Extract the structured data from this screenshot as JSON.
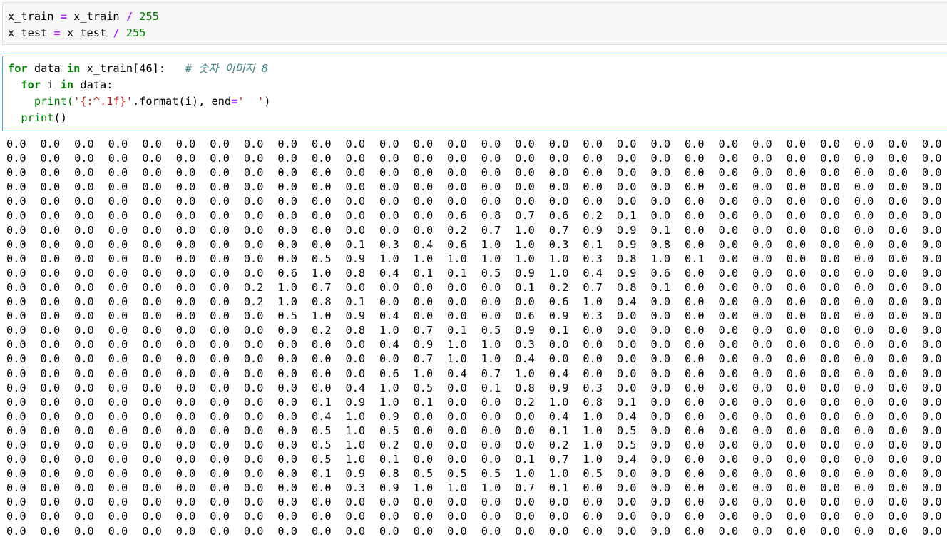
{
  "cell1": {
    "lines": [
      {
        "var": "x_train",
        "eq": "=",
        "src": "x_train",
        "op": "/",
        "num": "255"
      },
      {
        "var": "x_test",
        "eq": "=",
        "src": "x_test",
        "op": "/",
        "num": "255"
      }
    ]
  },
  "cell2": {
    "line1": {
      "kw_for": "for",
      "var": "data",
      "kw_in": "in",
      "iter": "x_train[46]:",
      "comment": "# 숫자 이미지 8"
    },
    "line2": {
      "kw_for": "for",
      "var": "i",
      "kw_in": "in",
      "iter": "data:"
    },
    "line3": {
      "fn": "print(",
      "str1": "'{:^.1f}'",
      "method": ".format",
      "args": "(i), ",
      "kw": "end",
      "eq": "=",
      "str2": "'  '",
      "close": ")"
    },
    "line4": {
      "fn": "print",
      "args": "()"
    }
  },
  "output": {
    "rows": [
      "0.0 0.0 0.0 0.0 0.0 0.0 0.0 0.0 0.0 0.0 0.0 0.0 0.0 0.0 0.0 0.0 0.0 0.0 0.0 0.0 0.0 0.0 0.0 0.0 0.0 0.0 0.0 0.0",
      "0.0 0.0 0.0 0.0 0.0 0.0 0.0 0.0 0.0 0.0 0.0 0.0 0.0 0.0 0.0 0.0 0.0 0.0 0.0 0.0 0.0 0.0 0.0 0.0 0.0 0.0 0.0 0.0",
      "0.0 0.0 0.0 0.0 0.0 0.0 0.0 0.0 0.0 0.0 0.0 0.0 0.0 0.0 0.0 0.0 0.0 0.0 0.0 0.0 0.0 0.0 0.0 0.0 0.0 0.0 0.0 0.0",
      "0.0 0.0 0.0 0.0 0.0 0.0 0.0 0.0 0.0 0.0 0.0 0.0 0.0 0.0 0.0 0.0 0.0 0.0 0.0 0.0 0.0 0.0 0.0 0.0 0.0 0.0 0.0 0.0",
      "0.0 0.0 0.0 0.0 0.0 0.0 0.0 0.0 0.0 0.0 0.0 0.0 0.0 0.0 0.0 0.0 0.0 0.0 0.0 0.0 0.0 0.0 0.0 0.0 0.0 0.0 0.0 0.0",
      "0.0 0.0 0.0 0.0 0.0 0.0 0.0 0.0 0.0 0.0 0.0 0.0 0.0 0.6 0.8 0.7 0.6 0.2 0.1 0.0 0.0 0.0 0.0 0.0 0.0 0.0 0.0 0.0",
      "0.0 0.0 0.0 0.0 0.0 0.0 0.0 0.0 0.0 0.0 0.0 0.0 0.0 0.2 0.7 1.0 0.7 0.9 0.9 0.1 0.0 0.0 0.0 0.0 0.0 0.0 0.0 0.0",
      "0.0 0.0 0.0 0.0 0.0 0.0 0.0 0.0 0.0 0.0 0.1 0.3 0.4 0.6 1.0 1.0 0.3 0.1 0.9 0.8 0.0 0.0 0.0 0.0 0.0 0.0 0.0 0.0",
      "0.0 0.0 0.0 0.0 0.0 0.0 0.0 0.0 0.0 0.5 0.9 1.0 1.0 1.0 1.0 1.0 1.0 0.3 0.8 1.0 0.1 0.0 0.0 0.0 0.0 0.0 0.0 0.0",
      "0.0 0.0 0.0 0.0 0.0 0.0 0.0 0.0 0.6 1.0 0.8 0.4 0.1 0.1 0.5 0.9 1.0 0.4 0.9 0.6 0.0 0.0 0.0 0.0 0.0 0.0 0.0 0.0",
      "0.0 0.0 0.0 0.0 0.0 0.0 0.0 0.2 1.0 0.7 0.0 0.0 0.0 0.0 0.0 0.1 0.2 0.7 0.8 0.1 0.0 0.0 0.0 0.0 0.0 0.0 0.0 0.0",
      "0.0 0.0 0.0 0.0 0.0 0.0 0.0 0.2 1.0 0.8 0.1 0.0 0.0 0.0 0.0 0.0 0.6 1.0 0.4 0.0 0.0 0.0 0.0 0.0 0.0 0.0 0.0 0.0",
      "0.0 0.0 0.0 0.0 0.0 0.0 0.0 0.0 0.5 1.0 0.9 0.4 0.0 0.0 0.0 0.6 0.9 0.3 0.0 0.0 0.0 0.0 0.0 0.0 0.0 0.0 0.0 0.0",
      "0.0 0.0 0.0 0.0 0.0 0.0 0.0 0.0 0.0 0.2 0.8 1.0 0.7 0.1 0.5 0.9 0.1 0.0 0.0 0.0 0.0 0.0 0.0 0.0 0.0 0.0 0.0 0.0",
      "0.0 0.0 0.0 0.0 0.0 0.0 0.0 0.0 0.0 0.0 0.0 0.4 0.9 1.0 1.0 0.3 0.0 0.0 0.0 0.0 0.0 0.0 0.0 0.0 0.0 0.0 0.0 0.0",
      "0.0 0.0 0.0 0.0 0.0 0.0 0.0 0.0 0.0 0.0 0.0 0.0 0.7 1.0 1.0 0.4 0.0 0.0 0.0 0.0 0.0 0.0 0.0 0.0 0.0 0.0 0.0 0.0",
      "0.0 0.0 0.0 0.0 0.0 0.0 0.0 0.0 0.0 0.0 0.0 0.6 1.0 0.4 0.7 1.0 0.4 0.0 0.0 0.0 0.0 0.0 0.0 0.0 0.0 0.0 0.0 0.0",
      "0.0 0.0 0.0 0.0 0.0 0.0 0.0 0.0 0.0 0.0 0.4 1.0 0.5 0.0 0.1 0.8 0.9 0.3 0.0 0.0 0.0 0.0 0.0 0.0 0.0 0.0 0.0 0.0",
      "0.0 0.0 0.0 0.0 0.0 0.0 0.0 0.0 0.0 0.1 0.9 1.0 0.1 0.0 0.0 0.2 1.0 0.8 0.1 0.0 0.0 0.0 0.0 0.0 0.0 0.0 0.0 0.0",
      "0.0 0.0 0.0 0.0 0.0 0.0 0.0 0.0 0.0 0.4 1.0 0.9 0.0 0.0 0.0 0.0 0.4 1.0 0.4 0.0 0.0 0.0 0.0 0.0 0.0 0.0 0.0 0.0",
      "0.0 0.0 0.0 0.0 0.0 0.0 0.0 0.0 0.0 0.5 1.0 0.5 0.0 0.0 0.0 0.0 0.1 1.0 0.5 0.0 0.0 0.0 0.0 0.0 0.0 0.0 0.0 0.0",
      "0.0 0.0 0.0 0.0 0.0 0.0 0.0 0.0 0.0 0.5 1.0 0.2 0.0 0.0 0.0 0.0 0.2 1.0 0.5 0.0 0.0 0.0 0.0 0.0 0.0 0.0 0.0 0.0",
      "0.0 0.0 0.0 0.0 0.0 0.0 0.0 0.0 0.0 0.5 1.0 0.1 0.0 0.0 0.0 0.1 0.7 1.0 0.4 0.0 0.0 0.0 0.0 0.0 0.0 0.0 0.0 0.0",
      "0.0 0.0 0.0 0.0 0.0 0.0 0.0 0.0 0.0 0.1 0.9 0.8 0.5 0.5 0.5 1.0 1.0 0.5 0.0 0.0 0.0 0.0 0.0 0.0 0.0 0.0 0.0 0.0",
      "0.0 0.0 0.0 0.0 0.0 0.0 0.0 0.0 0.0 0.0 0.3 0.9 1.0 1.0 1.0 0.7 0.1 0.0 0.0 0.0 0.0 0.0 0.0 0.0 0.0 0.0 0.0 0.0",
      "0.0 0.0 0.0 0.0 0.0 0.0 0.0 0.0 0.0 0.0 0.0 0.0 0.0 0.0 0.0 0.0 0.0 0.0 0.0 0.0 0.0 0.0 0.0 0.0 0.0 0.0 0.0 0.0",
      "0.0 0.0 0.0 0.0 0.0 0.0 0.0 0.0 0.0 0.0 0.0 0.0 0.0 0.0 0.0 0.0 0.0 0.0 0.0 0.0 0.0 0.0 0.0 0.0 0.0 0.0 0.0 0.0",
      "0.0 0.0 0.0 0.0 0.0 0.0 0.0 0.0 0.0 0.0 0.0 0.0 0.0 0.0 0.0 0.0 0.0 0.0 0.0 0.0 0.0 0.0 0.0 0.0 0.0 0.0 0.0 0.0"
    ]
  }
}
